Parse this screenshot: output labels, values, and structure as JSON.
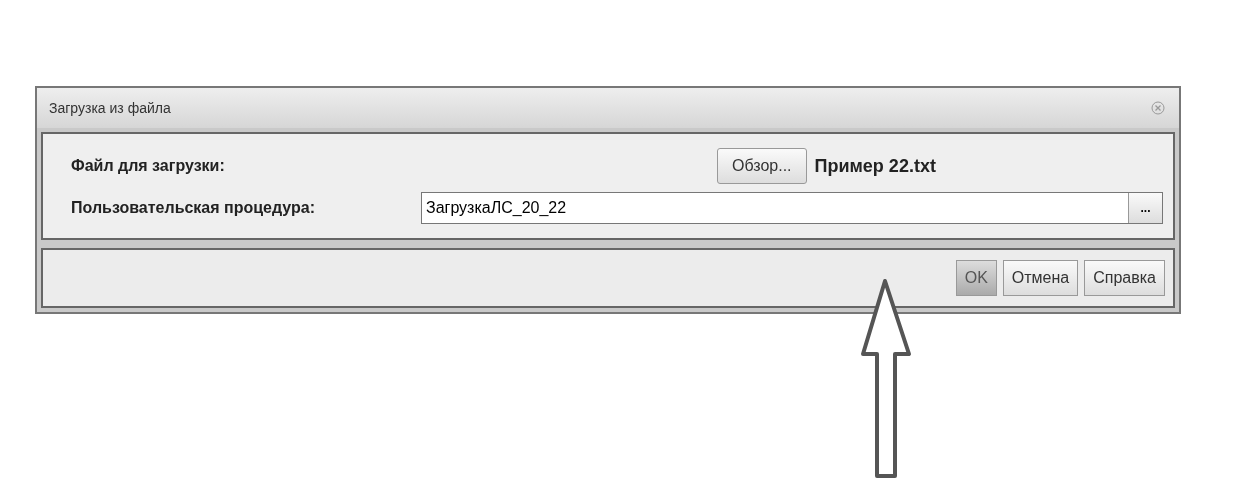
{
  "window": {
    "title": "Загрузка из файла"
  },
  "file_row": {
    "label": "Файл для загрузки:",
    "browse_button": "Обзор...",
    "file_name": "Пример 22.txt"
  },
  "procedure_row": {
    "label": "Пользовательская процедура:",
    "value": "ЗагрузкаЛС_20_22",
    "picker_button": "..."
  },
  "buttons": [
    {
      "label": "OK",
      "pressed": true
    },
    {
      "label": "Отмена",
      "pressed": false
    },
    {
      "label": "Справка",
      "pressed": false
    }
  ]
}
